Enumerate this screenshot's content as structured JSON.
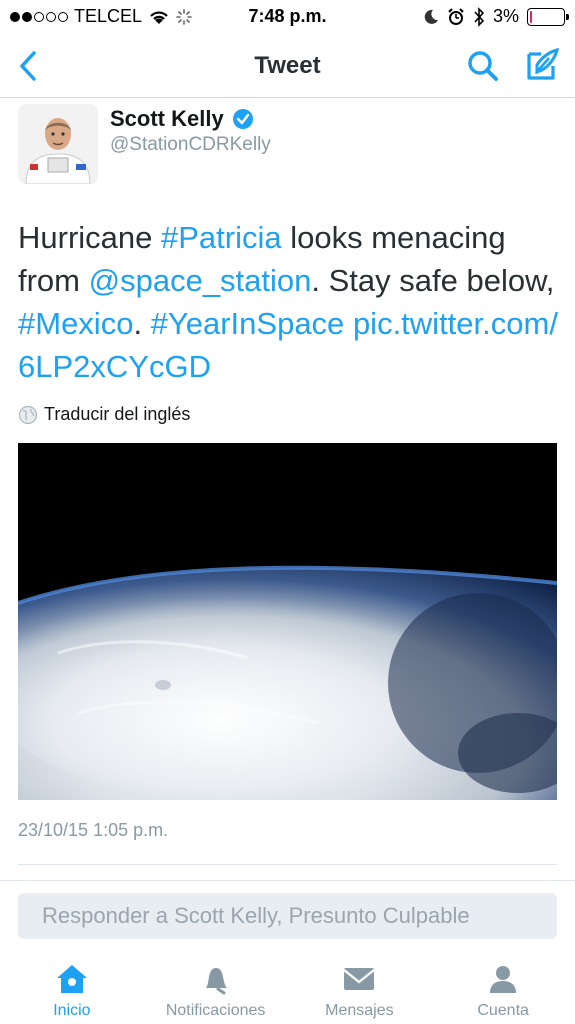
{
  "status": {
    "carrier": "TELCEL",
    "time": "7:48 p.m.",
    "battery": "3%",
    "battery_level": 0.03
  },
  "nav": {
    "title": "Tweet"
  },
  "tweet": {
    "user_name": "Scott Kelly",
    "user_handle": "@StationCDRKelly",
    "text_parts": {
      "p1": "Hurricane ",
      "h1": "#Patricia",
      "p2": " looks menacing from ",
      "m1": "@space_station",
      "p3": ". Stay safe below, ",
      "h2": "#Mexico",
      "p4": ". ",
      "h3": "#YearInSpace",
      "p5": " ",
      "url": "pic.twitter.com/6LP2xCYcGD"
    },
    "translate": "Traducir del inglés",
    "timestamp": "23/10/15 1:05 p.m."
  },
  "reply": {
    "placeholder": "Responder a Scott Kelly, Presunto Culpable"
  },
  "tabs": {
    "home": "Inicio",
    "notifications": "Notificaciones",
    "messages": "Mensajes",
    "account": "Cuenta"
  },
  "colors": {
    "accent": "#1da1f2",
    "muted": "#8899a6"
  }
}
